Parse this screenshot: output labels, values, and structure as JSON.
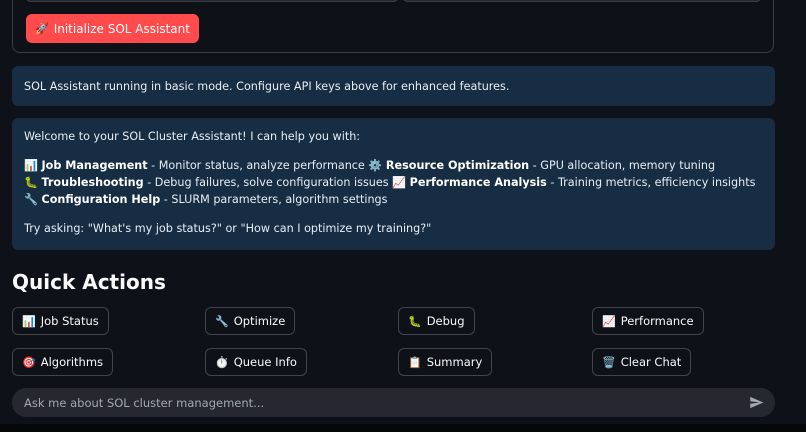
{
  "init_button": {
    "icon": "🚀",
    "label": "Initialize SOL Assistant"
  },
  "info_message": "SOL Assistant running in basic mode. Configure API keys above for enhanced features.",
  "welcome": {
    "intro": "Welcome to your SOL Cluster Assistant! I can help you with:",
    "items": [
      {
        "icon": "📊",
        "title": "Job Management",
        "desc": " - Monitor status, analyze performance "
      },
      {
        "icon": "⚙️",
        "title": "Resource Optimization",
        "desc": " - GPU allocation, memory tuning"
      },
      {
        "icon": "🐛",
        "title": "Troubleshooting",
        "desc": " - Debug failures, solve configuration issues "
      },
      {
        "icon": "📈",
        "title": "Performance Analysis",
        "desc": " - Training metrics, efficiency insights "
      },
      {
        "icon": "🔧",
        "title": "Configuration Help",
        "desc": " - SLURM parameters, algorithm settings"
      }
    ],
    "try_text": "Try asking: \"What's my job status?\" or \"How can I optimize my training?\""
  },
  "quick_actions": {
    "title": "Quick Actions",
    "buttons": [
      {
        "icon": "📊",
        "label": "Job Status"
      },
      {
        "icon": "🔧",
        "label": "Optimize"
      },
      {
        "icon": "🐛",
        "label": "Debug"
      },
      {
        "icon": "📈",
        "label": "Performance"
      },
      {
        "icon": "🎯",
        "label": "Algorithms"
      },
      {
        "icon": "⏱️",
        "label": "Queue Info"
      },
      {
        "icon": "📋",
        "label": "Summary"
      },
      {
        "icon": "🗑️",
        "label": "Clear Chat"
      }
    ]
  },
  "chat": {
    "placeholder": "Ask me about SOL cluster management...",
    "send_icon": "send-icon"
  },
  "colors": {
    "accent": "#ff4b4b",
    "info_bg": "#172d43",
    "background": "#0e1117"
  }
}
